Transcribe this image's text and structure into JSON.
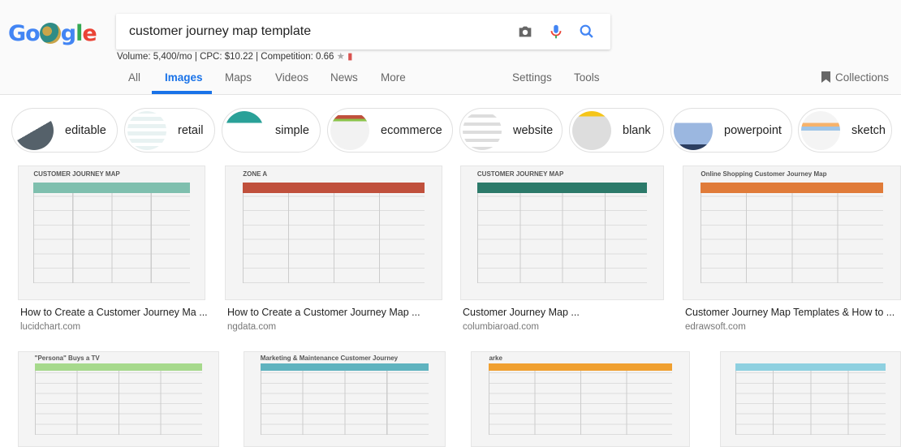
{
  "header": {
    "logo_text": "Google",
    "query": "customer journey map template",
    "stats": "Volume: 5,400/mo | CPC: $10.22 | Competition: 0.66"
  },
  "tabs": [
    {
      "label": "All"
    },
    {
      "label": "Images",
      "active": true
    },
    {
      "label": "Maps"
    },
    {
      "label": "Videos"
    },
    {
      "label": "News"
    },
    {
      "label": "More"
    }
  ],
  "tools": {
    "settings": "Settings",
    "tools": "Tools",
    "collections": "Collections"
  },
  "chips": [
    {
      "label": "editable"
    },
    {
      "label": "retail"
    },
    {
      "label": "simple"
    },
    {
      "label": "ecommerce"
    },
    {
      "label": "website"
    },
    {
      "label": "blank"
    },
    {
      "label": "powerpoint"
    },
    {
      "label": "sketch"
    }
  ],
  "results": [
    {
      "title": "How to Create a Customer Journey Ma ...",
      "source": "lucidchart.com",
      "thumb_text": "CUSTOMER JOURNEY MAP",
      "accent": "#7fbfae"
    },
    {
      "title": "How to Create a Customer Journey Map ...",
      "source": "ngdata.com",
      "thumb_text": "ZONE A",
      "accent": "#c0503c"
    },
    {
      "title": "Customer Journey Map ...",
      "source": "columbiaroad.com",
      "thumb_text": "CUSTOMER JOURNEY MAP",
      "accent": "#2c7a6a"
    },
    {
      "title": "Customer Journey Map Templates & How to ...",
      "source": "edrawsoft.com",
      "thumb_text": "Online Shopping Customer Journey Map",
      "accent": "#e07b39"
    },
    {
      "title": "",
      "source": "",
      "thumb_text": "\"Persona\" Buys a TV",
      "accent": "#a6d98c"
    },
    {
      "title": "",
      "source": "",
      "thumb_text": "Marketing & Maintenance Customer Journey",
      "accent": "#5fb3bf"
    },
    {
      "title": "",
      "source": "",
      "thumb_text": "arke",
      "accent": "#f0a030"
    },
    {
      "title": "",
      "source": "",
      "thumb_text": "",
      "accent": "#8ed0e0"
    }
  ]
}
